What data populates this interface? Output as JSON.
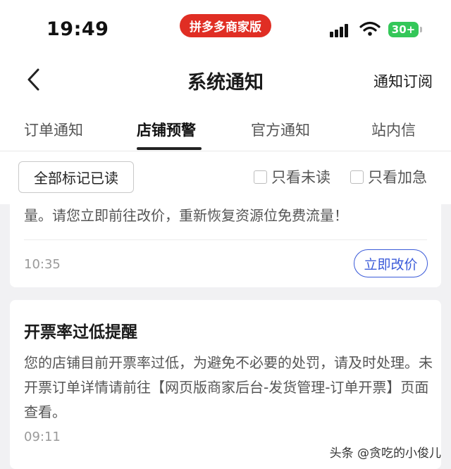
{
  "status_bar": {
    "time": "19:49",
    "app_badge": "拼多多商家版",
    "battery": "30+",
    "brand_color": "#e02e24",
    "battery_color": "#34c759"
  },
  "nav": {
    "title": "系统通知",
    "subscribe": "通知订阅"
  },
  "tabs": [
    {
      "label": "订单通知"
    },
    {
      "label": "店铺预警",
      "active": true
    },
    {
      "label": "官方通知"
    },
    {
      "label": "站内信"
    }
  ],
  "filters": {
    "mark_all_read": "全部标记已读",
    "unread_only": "只看未读",
    "urgent_only": "只看加急"
  },
  "messages": [
    {
      "text": "量。请您立即前往改价，重新恢复资源位免费流量！",
      "time": "10:35",
      "action": "立即改价"
    },
    {
      "title": "开票率过低提醒",
      "body": "您的店铺目前开票率过低，为避免不必要的处罚，请及时处理。未开票订单详情请前往【网页版商家后台-发货管理-订单开票】页面查看。",
      "time": "09:11"
    }
  ],
  "watermark": "头条 @贪吃的小俊儿",
  "accent_color": "#3b5bd9"
}
